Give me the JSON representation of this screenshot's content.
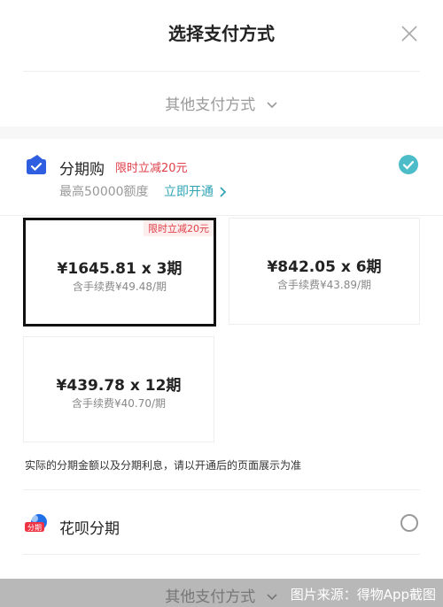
{
  "header": {
    "title": "选择支付方式"
  },
  "other_payment": {
    "label": "其他支付方式"
  },
  "fenqigou": {
    "name": "分期购",
    "promo": "限时立减20元",
    "limit_text": "最高50000额度",
    "open_link": "立即开通",
    "selected": true
  },
  "plans": [
    {
      "price": "¥1645.81 x 3期",
      "fee": "含手续费¥49.48/期",
      "tag": "限时立减20元",
      "selected": true
    },
    {
      "price": "¥842.05 x 6期",
      "fee": "含手续费¥43.89/期",
      "tag": "",
      "selected": false
    },
    {
      "price": "¥439.78 x 12期",
      "fee": "含手续费¥40.70/期",
      "tag": "",
      "selected": false
    }
  ],
  "note": "实际的分期金额以及分期利息，请以开通后的页面展示为准",
  "huabei": {
    "name": "花呗分期",
    "icon_text": "分期",
    "selected": false
  },
  "bottom": {
    "other_payment_label": "其他支付方式",
    "credit": "图片来源：得物App截图"
  },
  "colors": {
    "accent": "#2fa3b4",
    "promo": "#e0404a",
    "check": "#4cbcc9"
  }
}
